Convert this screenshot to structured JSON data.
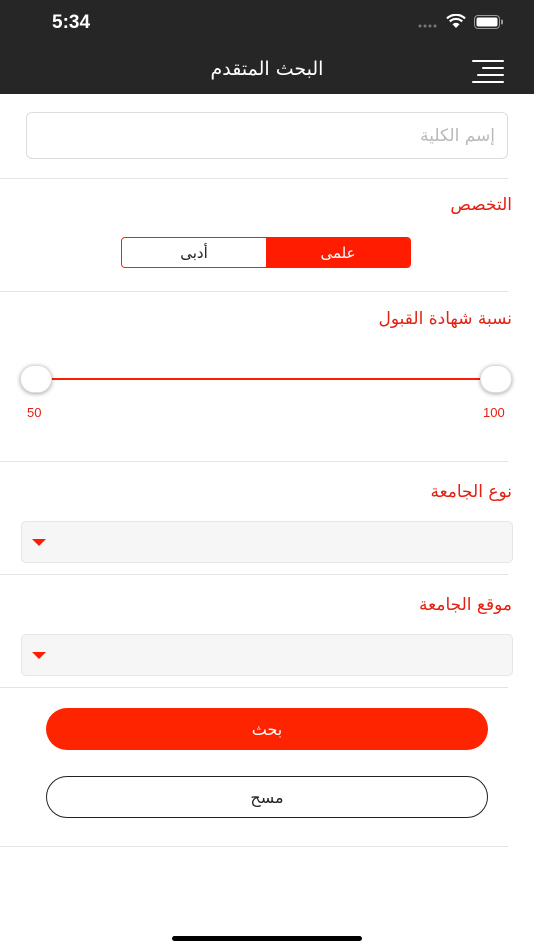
{
  "status_bar": {
    "time": "5:34",
    "icons": [
      "dots-icon",
      "wifi-icon",
      "battery-icon"
    ]
  },
  "header": {
    "title": "البحث المتقدم",
    "menu_icon": "hamburger-menu-icon"
  },
  "college_name": {
    "placeholder": "إسم الكلية",
    "value": ""
  },
  "specialization": {
    "label": "التخصص",
    "options": [
      "أدبى",
      "علمى"
    ],
    "selected": "علمى"
  },
  "acceptance": {
    "label": "نسبة شهادة القبول",
    "min_label": "50",
    "max_label": "100",
    "selected_min": 50,
    "selected_max": 100
  },
  "university_type": {
    "label": "نوع الجامعة",
    "value": ""
  },
  "university_location": {
    "label": "موقع الجامعة",
    "value": ""
  },
  "actions": {
    "search": "بحث",
    "clear": "مسح"
  },
  "colors": {
    "accent": "#ff1c00",
    "label": "#e32012",
    "header": "#262626"
  }
}
